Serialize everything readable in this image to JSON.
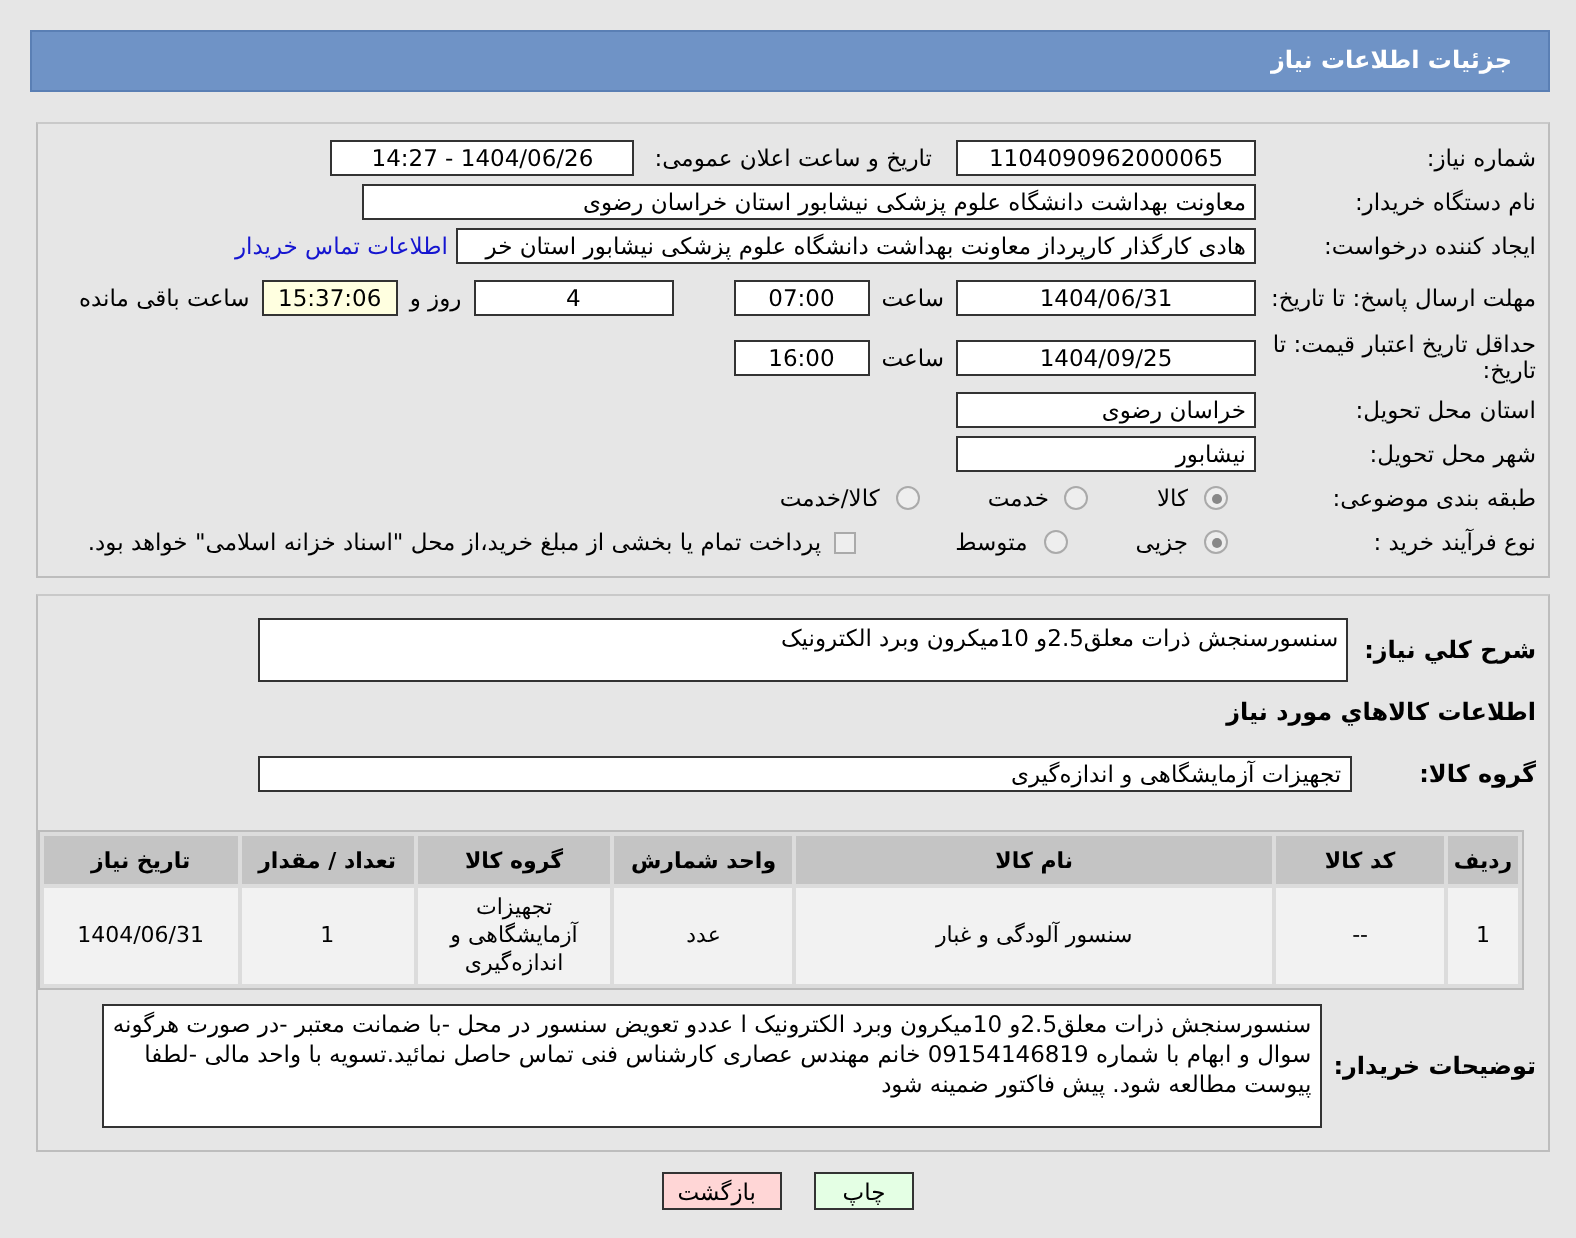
{
  "header": {
    "title": "جزئیات اطلاعات نیاز"
  },
  "need_number": {
    "label": "شماره نیاز:",
    "value": "1104090962000065"
  },
  "announce": {
    "label": "تاریخ و ساعت اعلان عمومی:",
    "value": "1404/06/26 - 14:27"
  },
  "buyer": {
    "label": "نام دستگاه خریدار:",
    "value": "معاونت بهداشت دانشگاه علوم پزشکی نیشابور استان خراسان رضوی"
  },
  "requester": {
    "label": "ایجاد کننده درخواست:",
    "value": "هادی کارگذار کارپرداز معاونت بهداشت دانشگاه علوم پزشکی نیشابور استان خر",
    "link": "اطلاعات تماس خریدار"
  },
  "deadline": {
    "label": "مهلت ارسال پاسخ: تا تاریخ:",
    "date": "1404/06/31",
    "time_label": "ساعت",
    "time": "07:00",
    "days": "4",
    "days_label": "روز و",
    "remaining": "15:37:06",
    "remaining_label": "ساعت باقی مانده"
  },
  "validity": {
    "label": "حداقل تاریخ اعتبار قیمت: تا تاریخ:",
    "date": "1404/09/25",
    "time_label": "ساعت",
    "time": "16:00"
  },
  "province": {
    "label": "استان محل تحویل:",
    "value": "خراسان رضوی"
  },
  "city": {
    "label": "شهر محل تحویل:",
    "value": "نیشابور"
  },
  "category": {
    "label": "طبقه بندی موضوعی:",
    "options": [
      {
        "label": "کالا",
        "selected": true
      },
      {
        "label": "خدمت",
        "selected": false
      },
      {
        "label": "کالا/خدمت",
        "selected": false
      }
    ]
  },
  "process": {
    "label": "نوع فرآیند خرید :",
    "options": [
      {
        "label": "جزیی",
        "selected": true
      },
      {
        "label": "متوسط",
        "selected": false
      }
    ],
    "checkbox": {
      "label": "پرداخت تمام یا بخشی از مبلغ خرید،از محل \"اسناد خزانه اسلامی\" خواهد بود.",
      "checked": false
    }
  },
  "summary": {
    "label": "شرح کلي نياز:",
    "value": "سنسورسنجش ذرات معلق2.5و 10میکرون وبرد الکترونیک"
  },
  "goods_title": "اطلاعات کالاهاي مورد نياز",
  "group": {
    "label": "گروه کالا:",
    "value": "تجهیزات آزمایشگاهی و اندازه‌گیری"
  },
  "table": {
    "columns": [
      "ردیف",
      "کد کالا",
      "نام کالا",
      "واحد شمارش",
      "گروه کالا",
      "تعداد / مقدار",
      "تاریخ نیاز"
    ],
    "rows": [
      [
        "1",
        "--",
        "سنسور آلودگی و غبار",
        "عدد",
        "تجهیزات آزمایشگاهی و اندازه‌گیری",
        "1",
        "1404/06/31"
      ]
    ]
  },
  "notes": {
    "label": "توضیحات خریدار:",
    "value": "سنسورسنجش ذرات معلق2.5و 10میکرون وبرد الکترونیک ا عددو تعویض سنسور در محل -با ضمانت معتبر -در صورت هرگونه سوال و ابهام با شماره  09154146819 خانم مهندس عصاری کارشناس فنی تماس حاصل نمائید.تسویه با واحد مالی -لطفا پیوست مطالعه شود. پیش فاکتور ضمینه شود"
  },
  "buttons": [
    {
      "label": "چاپ",
      "kind": "print"
    },
    {
      "label": "بازگشت",
      "kind": "back"
    }
  ]
}
